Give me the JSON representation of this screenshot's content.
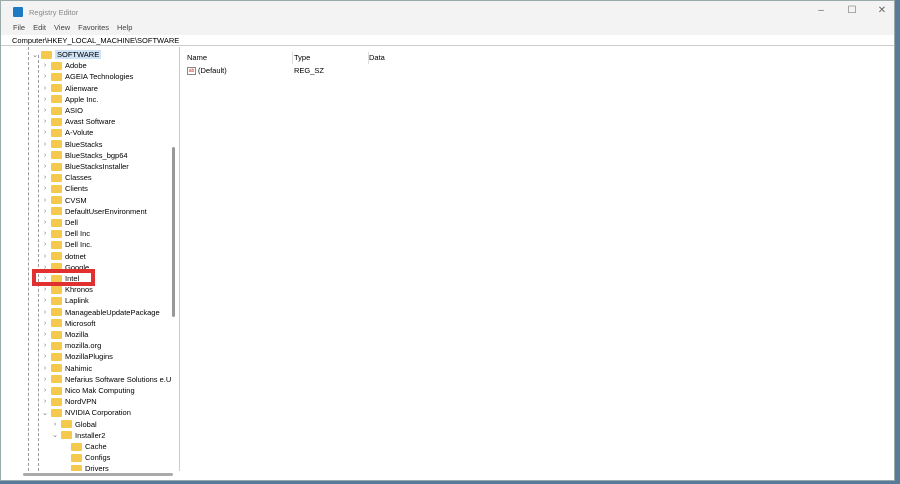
{
  "window": {
    "title": "Registry Editor",
    "controls": [
      "–",
      "☐",
      "✕"
    ]
  },
  "menu": [
    "File",
    "Edit",
    "View",
    "Favorites",
    "Help"
  ],
  "address": "Computer\\HKEY_LOCAL_MACHINE\\SOFTWARE",
  "tree": [
    {
      "label": "SOFTWARE",
      "level": 0,
      "expanded": true,
      "selected": true
    },
    {
      "label": "Adobe",
      "level": 1
    },
    {
      "label": "AGEIA Technologies",
      "level": 1
    },
    {
      "label": "Alienware",
      "level": 1
    },
    {
      "label": "Apple Inc.",
      "level": 1
    },
    {
      "label": "ASIO",
      "level": 1
    },
    {
      "label": "Avast Software",
      "level": 1
    },
    {
      "label": "A-Volute",
      "level": 1
    },
    {
      "label": "BlueStacks",
      "level": 1
    },
    {
      "label": "BlueStacks_bgp64",
      "level": 1
    },
    {
      "label": "BlueStacksInstaller",
      "level": 1
    },
    {
      "label": "Classes",
      "level": 1
    },
    {
      "label": "Clients",
      "level": 1
    },
    {
      "label": "CVSM",
      "level": 1
    },
    {
      "label": "DefaultUserEnvironment",
      "level": 1
    },
    {
      "label": "Dell",
      "level": 1
    },
    {
      "label": "Dell Inc",
      "level": 1
    },
    {
      "label": "Dell Inc.",
      "level": 1
    },
    {
      "label": "dotnet",
      "level": 1
    },
    {
      "label": "Google",
      "level": 1
    },
    {
      "label": "Intel",
      "level": 1,
      "highlighted": true
    },
    {
      "label": "Khronos",
      "level": 1
    },
    {
      "label": "Laplink",
      "level": 1
    },
    {
      "label": "ManageableUpdatePackage",
      "level": 1
    },
    {
      "label": "Microsoft",
      "level": 1
    },
    {
      "label": "Mozilla",
      "level": 1
    },
    {
      "label": "mozilla.org",
      "level": 1
    },
    {
      "label": "MozillaPlugins",
      "level": 1
    },
    {
      "label": "Nahimic",
      "level": 1
    },
    {
      "label": "Nefarius Software Solutions e.U",
      "level": 1
    },
    {
      "label": "Nico Mak Computing",
      "level": 1
    },
    {
      "label": "NordVPN",
      "level": 1
    },
    {
      "label": "NVIDIA Corporation",
      "level": 1,
      "expanded": true
    },
    {
      "label": "Global",
      "level": 2
    },
    {
      "label": "Installer2",
      "level": 2,
      "expanded": true
    },
    {
      "label": "Cache",
      "level": 3,
      "leaf": true
    },
    {
      "label": "Configs",
      "level": 3,
      "leaf": true
    },
    {
      "label": "Drivers",
      "level": 3,
      "leaf": true
    }
  ],
  "columns": [
    "Name",
    "Type",
    "Data"
  ],
  "values": [
    {
      "name": "(Default)",
      "type": "REG_SZ",
      "data": "",
      "icon": "ab"
    }
  ],
  "colors": {
    "highlight": "#e03030",
    "folder": "#f4c94e"
  }
}
